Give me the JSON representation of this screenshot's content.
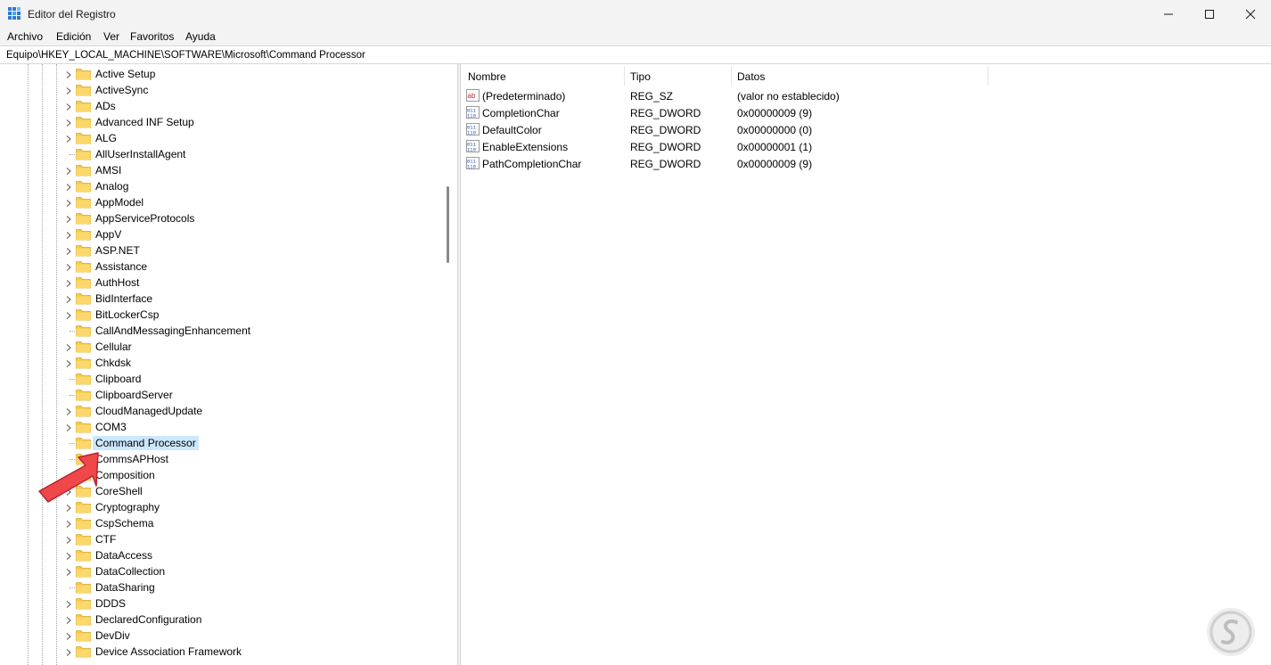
{
  "window": {
    "title": "Editor del Registro",
    "controls": [
      "minimize-icon",
      "maximize-icon",
      "close-icon"
    ]
  },
  "menu": [
    "Archivo",
    "Edición",
    "Ver",
    "Favoritos",
    "Ayuda"
  ],
  "address": "Equipo\\HKEY_LOCAL_MACHINE\\SOFTWARE\\Microsoft\\Command Processor",
  "tree": {
    "items": [
      {
        "label": "Active Setup",
        "expandable": true
      },
      {
        "label": "ActiveSync",
        "expandable": true
      },
      {
        "label": "ADs",
        "expandable": true
      },
      {
        "label": "Advanced INF Setup",
        "expandable": true
      },
      {
        "label": "ALG",
        "expandable": true
      },
      {
        "label": "AllUserInstallAgent",
        "expandable": false
      },
      {
        "label": "AMSI",
        "expandable": true
      },
      {
        "label": "Analog",
        "expandable": true
      },
      {
        "label": "AppModel",
        "expandable": true
      },
      {
        "label": "AppServiceProtocols",
        "expandable": true
      },
      {
        "label": "AppV",
        "expandable": true
      },
      {
        "label": "ASP.NET",
        "expandable": true
      },
      {
        "label": "Assistance",
        "expandable": true
      },
      {
        "label": "AuthHost",
        "expandable": true
      },
      {
        "label": "BidInterface",
        "expandable": true
      },
      {
        "label": "BitLockerCsp",
        "expandable": true
      },
      {
        "label": "CallAndMessagingEnhancement",
        "expandable": false
      },
      {
        "label": "Cellular",
        "expandable": true
      },
      {
        "label": "Chkdsk",
        "expandable": true
      },
      {
        "label": "Clipboard",
        "expandable": false
      },
      {
        "label": "ClipboardServer",
        "expandable": false
      },
      {
        "label": "CloudManagedUpdate",
        "expandable": true
      },
      {
        "label": "COM3",
        "expandable": true
      },
      {
        "label": "Command Processor",
        "expandable": false,
        "selected": true
      },
      {
        "label": "CommsAPHost",
        "expandable": false
      },
      {
        "label": "Composition",
        "expandable": false
      },
      {
        "label": "CoreShell",
        "expandable": true
      },
      {
        "label": "Cryptography",
        "expandable": true
      },
      {
        "label": "CspSchema",
        "expandable": true
      },
      {
        "label": "CTF",
        "expandable": true
      },
      {
        "label": "DataAccess",
        "expandable": true
      },
      {
        "label": "DataCollection",
        "expandable": true
      },
      {
        "label": "DataSharing",
        "expandable": false
      },
      {
        "label": "DDDS",
        "expandable": true
      },
      {
        "label": "DeclaredConfiguration",
        "expandable": true
      },
      {
        "label": "DevDiv",
        "expandable": true
      },
      {
        "label": "Device Association Framework",
        "expandable": true
      }
    ]
  },
  "list": {
    "columns": [
      "Nombre",
      "Tipo",
      "Datos"
    ],
    "rows": [
      {
        "icon": "string-value-icon",
        "name": "(Predeterminado)",
        "type": "REG_SZ",
        "data": "(valor no establecido)"
      },
      {
        "icon": "binary-value-icon",
        "name": "CompletionChar",
        "type": "REG_DWORD",
        "data": "0x00000009 (9)"
      },
      {
        "icon": "binary-value-icon",
        "name": "DefaultColor",
        "type": "REG_DWORD",
        "data": "0x00000000 (0)"
      },
      {
        "icon": "binary-value-icon",
        "name": "EnableExtensions",
        "type": "REG_DWORD",
        "data": "0x00000001 (1)"
      },
      {
        "icon": "binary-value-icon",
        "name": "PathCompletionChar",
        "type": "REG_DWORD",
        "data": "0x00000009 (9)"
      }
    ]
  },
  "colors": {
    "selection": "#cce8ff",
    "folder": "#f8c94a",
    "arrow": "#f0474b"
  }
}
